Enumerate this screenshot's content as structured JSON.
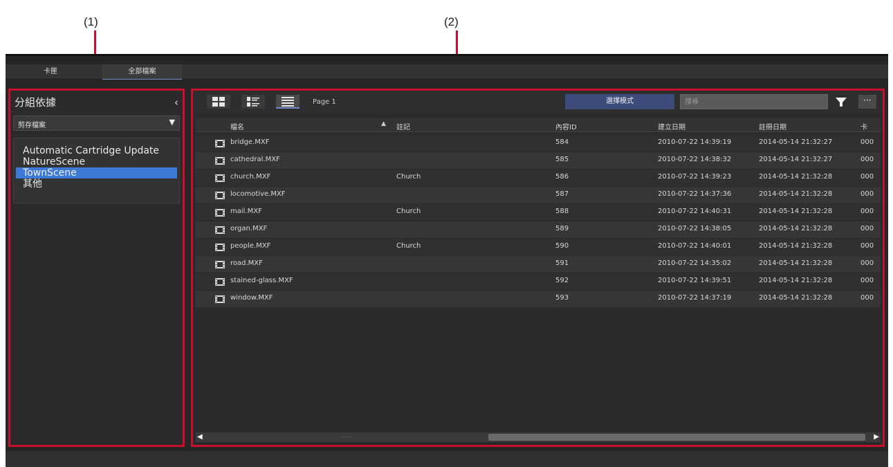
{
  "callouts": {
    "left": "(1)",
    "right": "(2)"
  },
  "tabs": [
    {
      "label": "卡匣"
    },
    {
      "label": "全部檔案"
    }
  ],
  "left_panel": {
    "title": "分組依據",
    "collapse_icon": "chevron-left-icon",
    "group_select": {
      "value": "剪存檔案",
      "icon": "dropdown-arrow-icon"
    },
    "groups": [
      {
        "label": "Automatic Cartridge Update"
      },
      {
        "label": "NatureScene"
      },
      {
        "label": "TownScene"
      },
      {
        "label": "其他"
      }
    ],
    "selected_group": "TownScene"
  },
  "toolbar": {
    "view_icons": [
      "large-thumbnail-view-icon",
      "small-thumbnail-view-icon",
      "list-view-icon"
    ],
    "active_view": "list-view-icon",
    "page_label": "Page 1",
    "mode_button": "選擇模式",
    "search_placeholder": "搜尋",
    "filter_icon": "filter-icon",
    "more_icon": "more-icon",
    "more_label": "···"
  },
  "table": {
    "columns": [
      "檔名",
      "註記",
      "內容ID",
      "建立日期",
      "註冊日期",
      "卡"
    ],
    "sort": {
      "column": "檔名",
      "direction": "ascending"
    },
    "rows": [
      {
        "name": "bridge.MXF",
        "note": "",
        "id": "584",
        "created": "2010-07-22 14:39:19",
        "registered": "2014-05-14 21:32:27",
        "card": "000"
      },
      {
        "name": "cathedral.MXF",
        "note": "",
        "id": "585",
        "created": "2010-07-22 14:38:32",
        "registered": "2014-05-14 21:32:27",
        "card": "000"
      },
      {
        "name": "church.MXF",
        "note": "Church",
        "id": "586",
        "created": "2010-07-22 14:39:23",
        "registered": "2014-05-14 21:32:28",
        "card": "000"
      },
      {
        "name": "locomotive.MXF",
        "note": "",
        "id": "587",
        "created": "2010-07-22 14:37:36",
        "registered": "2014-05-14 21:32:28",
        "card": "000"
      },
      {
        "name": "mail.MXF",
        "note": "Church",
        "id": "588",
        "created": "2010-07-22 14:40:31",
        "registered": "2014-05-14 21:32:28",
        "card": "000"
      },
      {
        "name": "organ.MXF",
        "note": "",
        "id": "589",
        "created": "2010-07-22 14:38:05",
        "registered": "2014-05-14 21:32:28",
        "card": "000"
      },
      {
        "name": "people.MXF",
        "note": "Church",
        "id": "590",
        "created": "2010-07-22 14:40:01",
        "registered": "2014-05-14 21:32:28",
        "card": "000"
      },
      {
        "name": "road.MXF",
        "note": "",
        "id": "591",
        "created": "2010-07-22 14:35:02",
        "registered": "2014-05-14 21:32:28",
        "card": "000"
      },
      {
        "name": "stained-glass.MXF",
        "note": "",
        "id": "592",
        "created": "2010-07-22 14:39:51",
        "registered": "2014-05-14 21:32:28",
        "card": "000"
      },
      {
        "name": "window.MXF",
        "note": "",
        "id": "593",
        "created": "2010-07-22 14:37:19",
        "registered": "2014-05-14 21:32:28",
        "card": "000"
      }
    ]
  },
  "scrollbar": {
    "left_icon": "scroll-left-icon",
    "right_icon": "scroll-right-icon",
    "grip": "......"
  },
  "colors": {
    "callout_border": "#c8102e",
    "selected": "#3d7ad6",
    "mode_button": "#3d4a7a",
    "background": "#262626"
  }
}
